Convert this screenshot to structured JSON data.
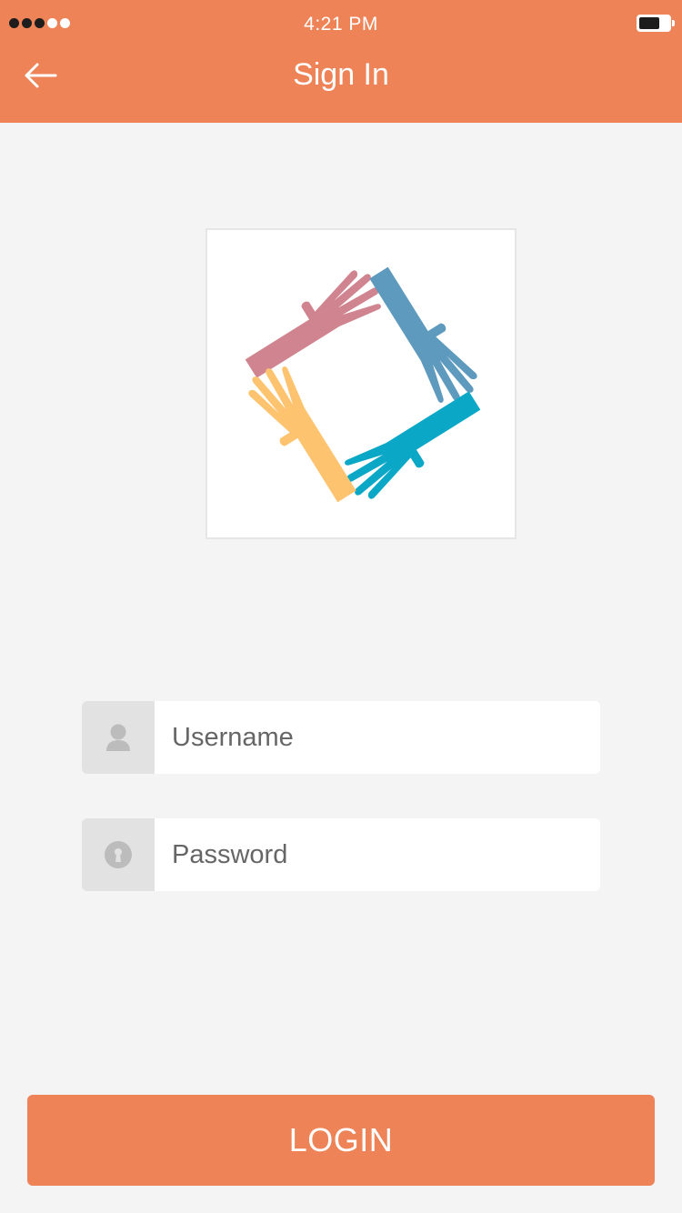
{
  "status_bar": {
    "time": "4:21 PM",
    "signal_bars_filled": 3,
    "signal_bars_total": 5,
    "battery_level": 0.7
  },
  "header": {
    "title": "Sign In",
    "back_icon": "arrow-left-icon",
    "background_color": "#ed8357"
  },
  "logo": {
    "icon": "four-hands-logo",
    "colors": {
      "pink_hand": "#cf848f",
      "blue_hand": "#5e9abd",
      "teal_hand": "#0aa8c6",
      "yellow_hand": "#fec36f"
    }
  },
  "form": {
    "username": {
      "icon": "user-icon",
      "placeholder": "Username",
      "value": ""
    },
    "password": {
      "icon": "keyhole-icon",
      "placeholder": "Password",
      "value": ""
    }
  },
  "login_button": {
    "label": "LOGIN",
    "color": "#ed8357"
  }
}
